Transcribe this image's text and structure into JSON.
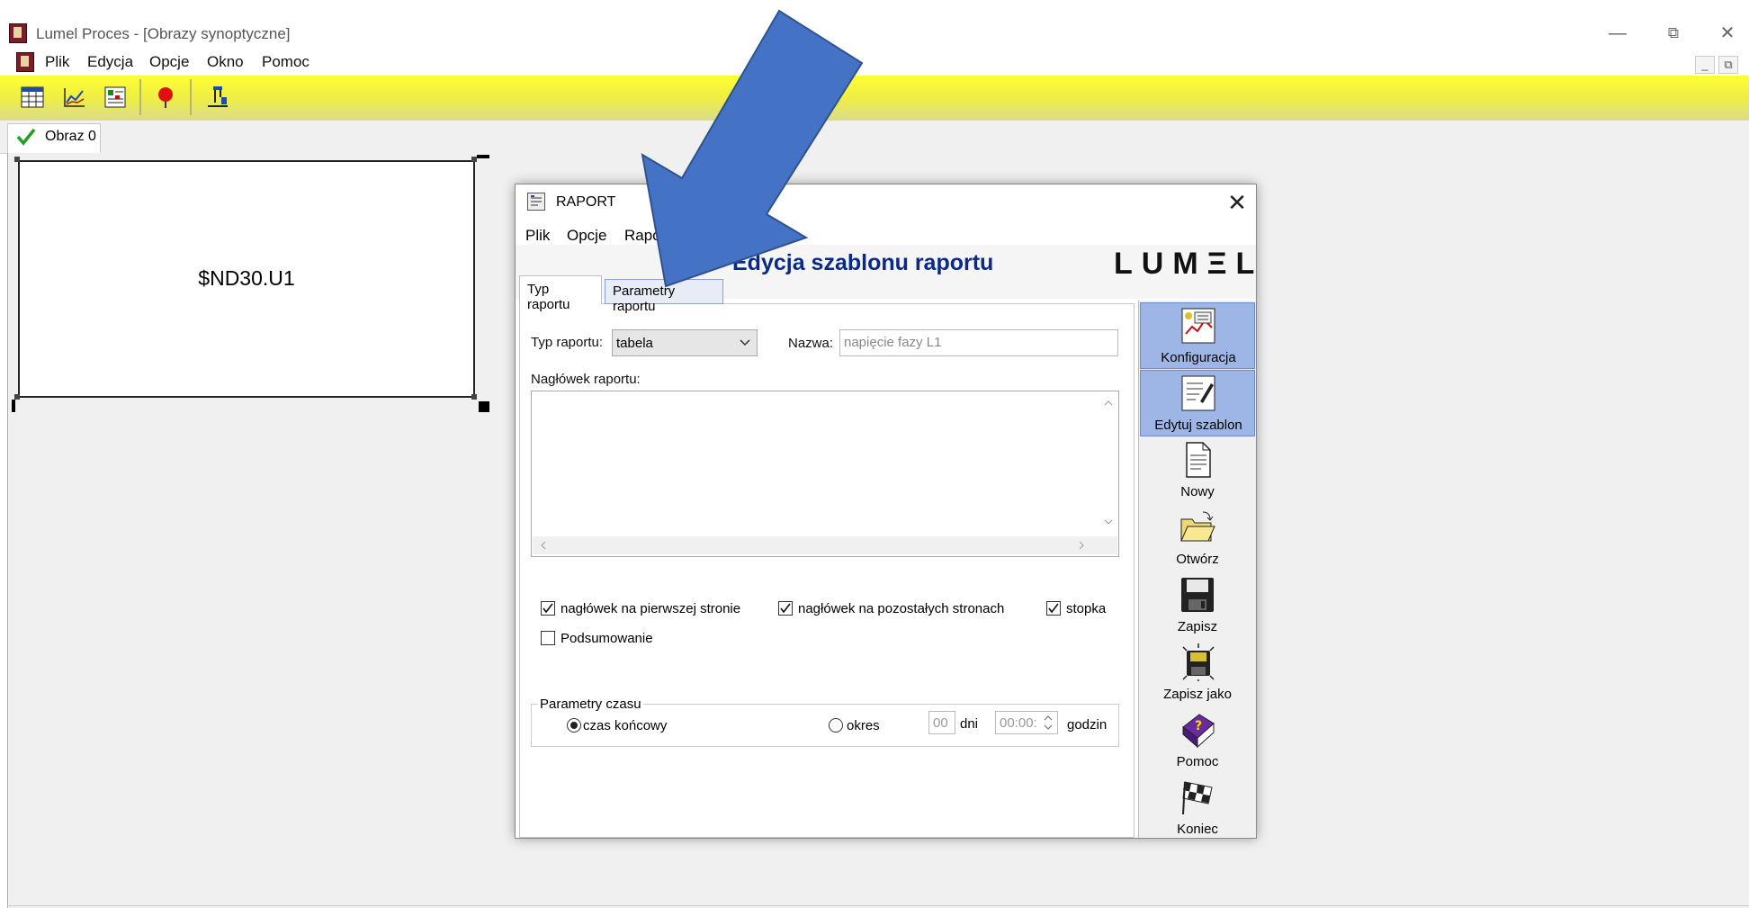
{
  "window": {
    "title": "Lumel Proces - [Obrazy synoptyczne]",
    "minimize": "—",
    "restore": "⧉",
    "close": "✕"
  },
  "menu": {
    "plik": "Plik",
    "edycja": "Edycja",
    "opcje": "Opcje",
    "okno": "Okno",
    "pomoc": "Pomoc"
  },
  "mdi": {
    "minimize": "_",
    "restore": "⧉"
  },
  "tabs": {
    "obraz": "Obraz 0"
  },
  "synoptic": {
    "label": "$ND30.U1"
  },
  "dialog": {
    "title": "RAPORT",
    "close": "✕",
    "menu": {
      "plik": "Plik",
      "opcje": "Opcje",
      "raport": "Raport"
    },
    "heading": "Edycja szablonu raportu",
    "logo": "LUMΞL",
    "tabs": {
      "typ": "Typ raportu",
      "param": "Parametry raportu"
    },
    "form": {
      "typ_label": "Typ raportu:",
      "typ_value": "tabela",
      "nazwa_label": "Nazwa:",
      "nazwa_value": "napięcie fazy L1",
      "naglowek_label": "Nagłówek raportu:",
      "cb_first": "nagłówek na pierwszej stronie",
      "cb_others": "nagłówek na pozostałych stronach",
      "cb_stopka": "stopka",
      "cb_podsumowanie": "Podsumowanie",
      "time_group": "Parametry czasu",
      "radio_czas": "czas końcowy",
      "radio_okres": "okres",
      "dni_value": "00",
      "dni_label": "dni",
      "godzin_value": "00:00:",
      "godzin_label": "godzin"
    },
    "side": {
      "konfiguracja": "Konfiguracja",
      "edytuj": "Edytuj szablon",
      "nowy": "Nowy",
      "otworz": "Otwórz",
      "zapisz": "Zapisz",
      "zapisz_jako": "Zapisz jako",
      "pomoc": "Pomoc",
      "koniec": "Koniec"
    }
  },
  "colors": {
    "toolbar": "#ffff33",
    "arrow": "#4472c4",
    "heading": "#0a2a8a",
    "active_side": "#9db6e6"
  }
}
